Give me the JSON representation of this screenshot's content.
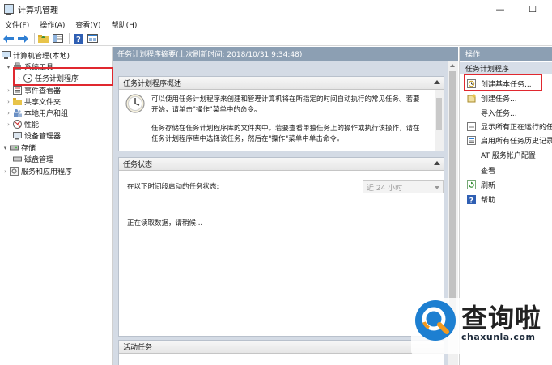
{
  "window": {
    "title": "计算机管理",
    "controls": {
      "minimize": "—",
      "maximize": "☐"
    }
  },
  "menu": [
    "文件(F)",
    "操作(A)",
    "查看(V)",
    "帮助(H)"
  ],
  "toolbar_icons": [
    "back-arrow-icon",
    "forward-arrow-icon",
    "up-folder-icon",
    "show-tree-icon",
    "help-icon",
    "properties-icon"
  ],
  "tree": {
    "root": "计算机管理(本地)",
    "system_tools": "系统工具",
    "task_scheduler": "任务计划程序",
    "event_viewer": "事件查看器",
    "shared_folders": "共享文件夹",
    "local_users": "本地用户和组",
    "performance": "性能",
    "device_manager": "设备管理器",
    "storage": "存储",
    "disk_management": "磁盘管理",
    "services_apps": "服务和应用程序"
  },
  "center": {
    "header": "任务计划程序摘要(上次刷新时间: 2018/10/31 9:34:48)",
    "overview": {
      "title": "任务计划程序概述",
      "para1_line1": "可以使用任务计划程序来创建和管理计算机将在所指定的时间自动执行的常见任务。若要",
      "para1_line2": "开始，请单击\"操作\"菜单中的命令。",
      "para2_line1": "任务存储在任务计划程序库的文件夹中。若要查看单独任务上的操作或执行该操作，请在",
      "para2_line2": "任务计划程序库中选择该任务，然后在\"操作\"菜单中单击命令。"
    },
    "status": {
      "title": "任务状态",
      "period_label": "在以下时间段启动的任务状态:",
      "period_value": "近 24 小时",
      "loading": "正在读取数据，请稍候..."
    },
    "active": {
      "title": "活动任务"
    }
  },
  "actions": {
    "header": "操作",
    "section": "任务计划程序",
    "items": [
      {
        "label": "创建基本任务...",
        "icon": "create-basic-task-icon"
      },
      {
        "label": "创建任务...",
        "icon": "create-task-icon"
      },
      {
        "label": "导入任务...",
        "icon": ""
      },
      {
        "label": "显示所有正在运行的任务",
        "icon": "running-tasks-icon"
      },
      {
        "label": "启用所有任务历史记录",
        "icon": "task-history-icon"
      },
      {
        "label": "AT 服务帐户配置",
        "icon": ""
      },
      {
        "label": "查看",
        "icon": ""
      },
      {
        "label": "刷新",
        "icon": "refresh-icon"
      },
      {
        "label": "帮助",
        "icon": "help-icon"
      }
    ]
  },
  "watermark": {
    "brand": "查询啦",
    "url": "chaxunla.com"
  },
  "colors": {
    "header_bar": "#8c9fb3",
    "highlight_box": "#e0282f",
    "content_bg": "#d4dbe5"
  }
}
